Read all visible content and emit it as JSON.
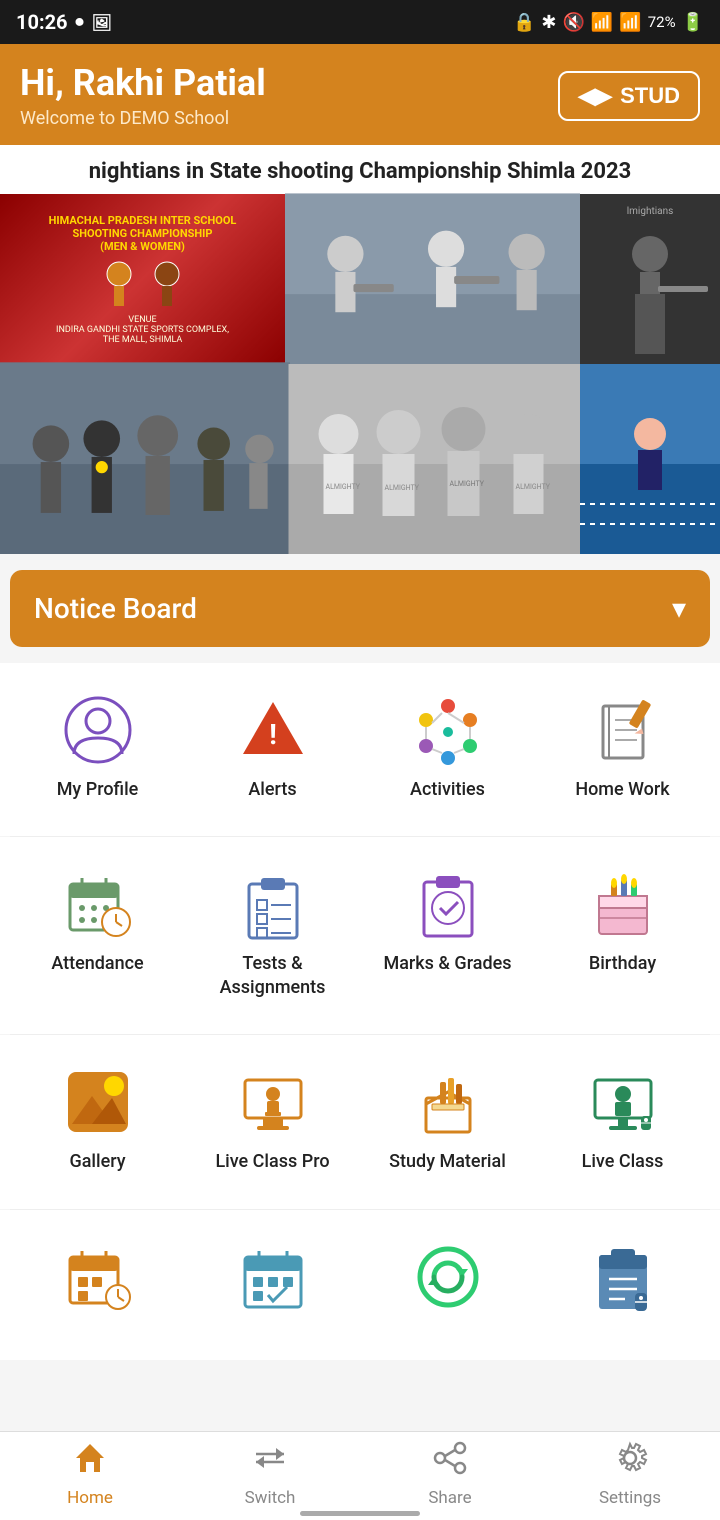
{
  "status_bar": {
    "time": "10:26",
    "battery": "72%"
  },
  "header": {
    "greeting": "Hi, Rakhi Patial",
    "subtitle": "Welcome to DEMO School",
    "button_label": "STUD"
  },
  "news": {
    "title": "nightians in State shooting Championship Shimla 2023",
    "side_label": "lmightians"
  },
  "notice_board": {
    "label": "Notice Board",
    "chevron": "▾"
  },
  "menu_rows": [
    [
      {
        "id": "my-profile",
        "label": "My Profile"
      },
      {
        "id": "alerts",
        "label": "Alerts"
      },
      {
        "id": "activities",
        "label": "Activities"
      },
      {
        "id": "home-work",
        "label": "Home Work"
      }
    ],
    [
      {
        "id": "attendance",
        "label": "Attendance"
      },
      {
        "id": "tests-assignments",
        "label": "Tests & Assignments"
      },
      {
        "id": "marks-grades",
        "label": "Marks & Grades"
      },
      {
        "id": "birthday",
        "label": "Birthday"
      }
    ],
    [
      {
        "id": "gallery",
        "label": "Gallery"
      },
      {
        "id": "live-class-pro",
        "label": "Live Class Pro"
      },
      {
        "id": "study-material",
        "label": "Study Material"
      },
      {
        "id": "live-class",
        "label": "Live Class"
      }
    ]
  ],
  "row4": [
    {
      "id": "item-r4-1",
      "label": ""
    },
    {
      "id": "item-r4-2",
      "label": ""
    },
    {
      "id": "item-r4-3",
      "label": ""
    },
    {
      "id": "item-r4-4",
      "label": ""
    }
  ],
  "bottom_nav": [
    {
      "id": "home",
      "label": "Home",
      "active": true
    },
    {
      "id": "switch",
      "label": "Switch",
      "active": false
    },
    {
      "id": "share",
      "label": "Share",
      "active": false
    },
    {
      "id": "settings",
      "label": "Settings",
      "active": false
    }
  ]
}
